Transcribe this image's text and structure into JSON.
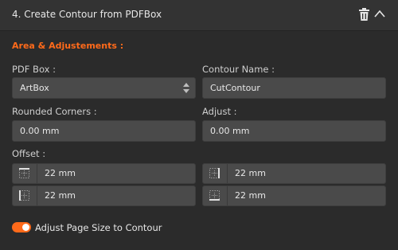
{
  "header": {
    "title": "4.  Create Contour from PDFBox",
    "icons": [
      "trash-icon",
      "chevron-up-icon"
    ]
  },
  "section": {
    "title": "Area & Adjustements :"
  },
  "fields": {
    "pdf_box": {
      "label": "PDF Box :",
      "value": "ArtBox"
    },
    "contour_name": {
      "label": "Contour Name :",
      "value": "CutContour"
    },
    "rounded_corners": {
      "label": "Rounded Corners :",
      "value": "0.00 mm"
    },
    "adjust": {
      "label": "Adjust :",
      "value": "0.00 mm"
    }
  },
  "offset": {
    "label": "Offset :",
    "top": "22 mm",
    "left": "22 mm",
    "right": "22 mm",
    "bottom": "22 mm"
  },
  "toggle": {
    "label": "Adjust Page Size to Contour",
    "on": true
  },
  "colors": {
    "accent": "#ff6a1a",
    "background": "#2b2b2b",
    "header": "#333333",
    "field": "#4a4a4a"
  }
}
